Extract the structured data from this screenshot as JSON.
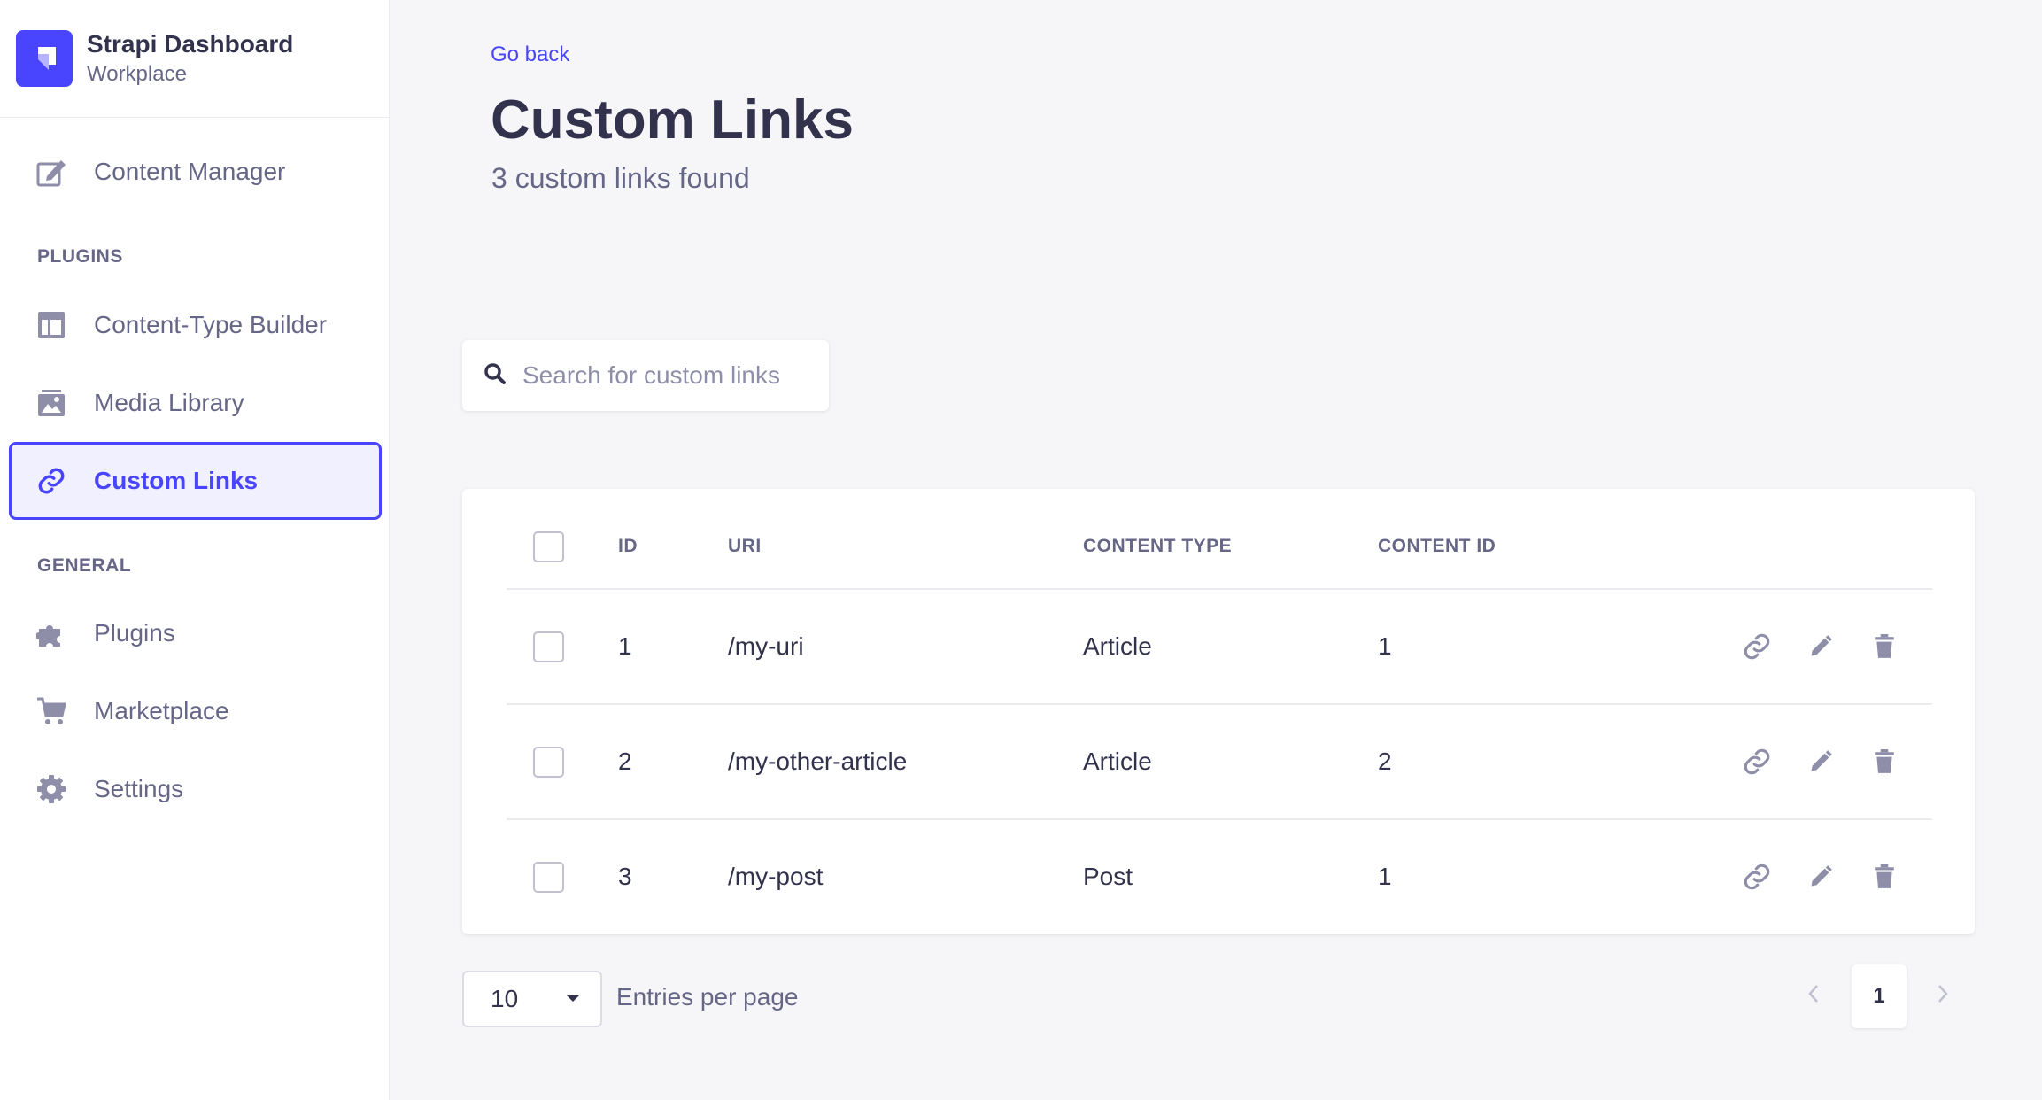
{
  "brand": {
    "title": "Strapi Dashboard",
    "subtitle": "Workplace"
  },
  "sidebar": {
    "content_manager": "Content Manager",
    "plugins_label": "PLUGINS",
    "content_type_builder": "Content-Type Builder",
    "media_library": "Media Library",
    "custom_links": "Custom Links",
    "general_label": "GENERAL",
    "plugins": "Plugins",
    "marketplace": "Marketplace",
    "settings": "Settings"
  },
  "header": {
    "go_back": "Go back",
    "title": "Custom Links",
    "subtitle": "3 custom links found"
  },
  "search": {
    "placeholder": "Search for custom links"
  },
  "table": {
    "columns": {
      "id": "ID",
      "uri": "URI",
      "content_type": "CONTENT TYPE",
      "content_id": "CONTENT ID"
    },
    "rows": [
      {
        "id": "1",
        "uri": "/my-uri",
        "content_type": "Article",
        "content_id": "1"
      },
      {
        "id": "2",
        "uri": "/my-other-article",
        "content_type": "Article",
        "content_id": "2"
      },
      {
        "id": "3",
        "uri": "/my-post",
        "content_type": "Post",
        "content_id": "1"
      }
    ]
  },
  "pagination": {
    "per_page": "10",
    "per_page_label": "Entries per page",
    "current_page": "1"
  },
  "colors": {
    "accent": "#4945ff",
    "muted": "#666687",
    "text": "#32324d"
  }
}
